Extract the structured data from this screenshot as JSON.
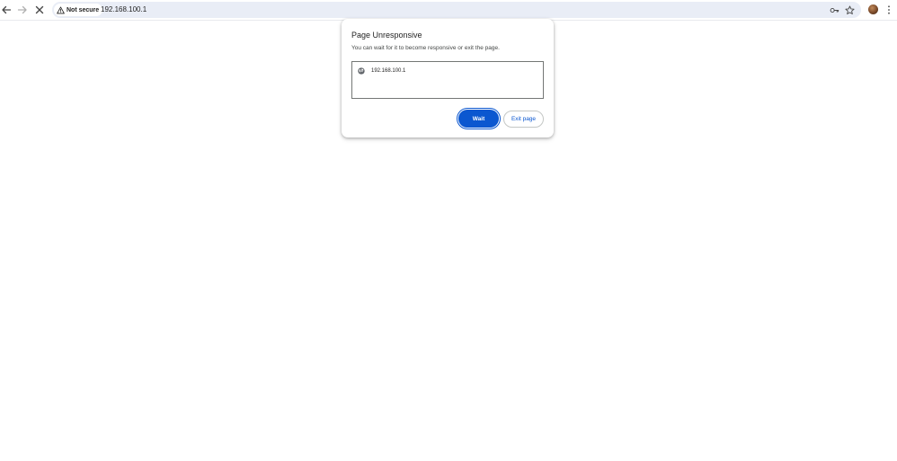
{
  "browser": {
    "security_label": "Not secure",
    "url": "192.168.100.1",
    "icons": {
      "back": "back-arrow-icon",
      "forward": "forward-arrow-icon",
      "stop": "stop-loading-icon",
      "warning": "warning-triangle-icon",
      "password_key": "key-icon",
      "bookmark": "star-icon",
      "profile": "avatar",
      "menu": "more-vertical-icon"
    }
  },
  "dialog": {
    "title": "Page Unresponsive",
    "message": "You can wait for it to become responsive or exit the page.",
    "pages": [
      {
        "icon": "globe-icon",
        "label": "192.168.100.1"
      }
    ],
    "wait_label": "Wait",
    "exit_label": "Exit page"
  },
  "colors": {
    "accent": "#0b57d0",
    "omnibox_bg": "#e9edf6",
    "text_primary": "#1f1f1f",
    "text_secondary": "#444746"
  }
}
